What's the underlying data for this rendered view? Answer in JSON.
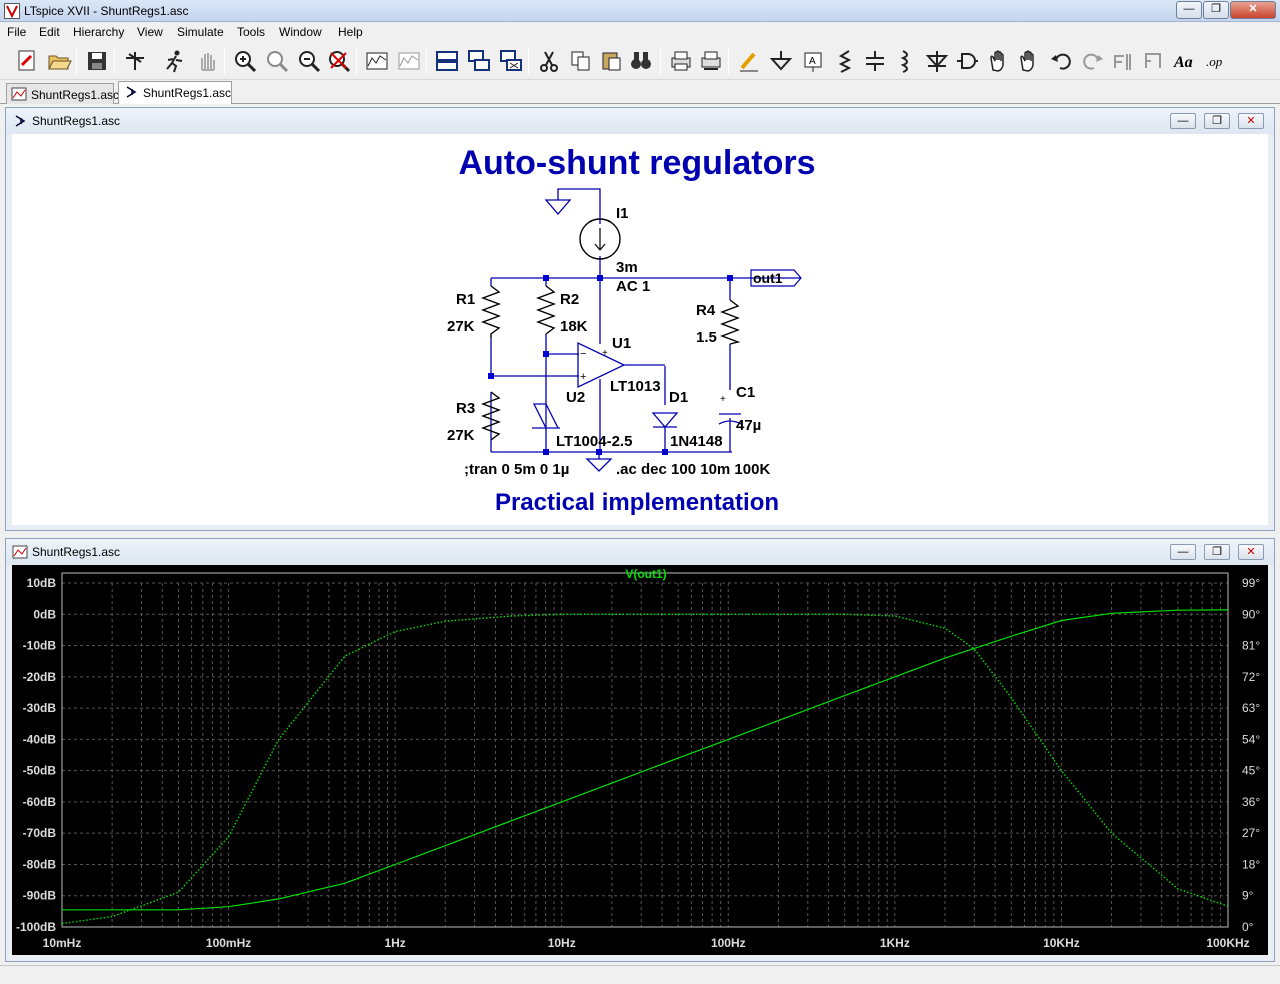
{
  "app": {
    "title": "LTspice XVII - ShuntRegs1.asc"
  },
  "menu": [
    "File",
    "Edit",
    "Hierarchy",
    "View",
    "Simulate",
    "Tools",
    "Window",
    "Help"
  ],
  "toolbar_icons": [
    "new-schematic-icon",
    "open-icon",
    "save-icon",
    "control-panel-icon",
    "run-icon",
    "halt-icon",
    "zoom-in-icon",
    "zoom-full-icon",
    "zoom-out-icon",
    "zoom-cancel-icon",
    "autorange-icon",
    "pick-visible-traces-icon",
    "tile-horizontal-icon",
    "cascade-icon",
    "close-windows-icon",
    "cut-icon",
    "copy-icon",
    "paste-icon",
    "find-icon",
    "print-icon",
    "print-setup-icon",
    "draw-wire-icon",
    "ground-icon",
    "label-net-icon",
    "resistor-icon",
    "capacitor-icon",
    "inductor-icon",
    "diode-icon",
    "component-icon",
    "move-icon",
    "drag-icon",
    "undo-icon",
    "redo-icon",
    "rotate-icon",
    "mirror-icon",
    "text-icon",
    "spice-directive-icon"
  ],
  "tabs": [
    "ShuntRegs1.asc",
    "ShuntRegs1.asc"
  ],
  "schematic": {
    "window_title": "ShuntRegs1.asc",
    "title": "Auto-shunt regulators",
    "subtitle": "Practical implementation",
    "labels": {
      "i1": "I1",
      "i1_val": "3m",
      "i1_ac": "AC 1",
      "r1": "R1",
      "r1_val": "27K",
      "r2": "R2",
      "r2_val": "18K",
      "r3": "R3",
      "r3_val": "27K",
      "r4": "R4",
      "r4_val": "1.5",
      "u1": "U1",
      "u1_model": "LT1013",
      "u2": "U2",
      "u2_model": "LT1004-2.5",
      "d1": "D1",
      "d1_model": "1N4148",
      "c1": "C1",
      "c1_val": "47µ",
      "out": "out1",
      "tran": ";tran 0 5m 0 1µ",
      "ac": ".ac dec 100 10m 100K"
    }
  },
  "waveform": {
    "window_title": "ShuntRegs1.asc",
    "trace": "V(out1)",
    "trace_color": "#00e000",
    "y_left_ticks": [
      "10dB",
      "0dB",
      "-10dB",
      "-20dB",
      "-30dB",
      "-40dB",
      "-50dB",
      "-60dB",
      "-70dB",
      "-80dB",
      "-90dB",
      "-100dB"
    ],
    "y_right_ticks": [
      "99°",
      "90°",
      "81°",
      "72°",
      "63°",
      "54°",
      "45°",
      "36°",
      "27°",
      "18°",
      "9°",
      "0°"
    ],
    "x_ticks": [
      "10mHz",
      "100mHz",
      "1Hz",
      "10Hz",
      "100Hz",
      "1KHz",
      "10KHz",
      "100KHz"
    ]
  },
  "chart_data": {
    "type": "line",
    "title": "V(out1)",
    "x_scale": "log",
    "xlim": [
      0.01,
      100000
    ],
    "ylim_left": [
      -100,
      10
    ],
    "ylim_right": [
      0,
      99
    ],
    "grid": true,
    "series": [
      {
        "name": "V(out1)",
        "axis": "left",
        "style": "solid",
        "x": [
          0.01,
          0.02,
          0.05,
          0.1,
          0.2,
          0.5,
          1,
          2,
          5,
          10,
          20,
          50,
          100,
          200,
          500,
          1000,
          2000,
          5000,
          10000,
          20000,
          50000,
          100000
        ],
        "y": [
          -94.5,
          -94.5,
          -94.5,
          -93.5,
          -91,
          -86,
          -80,
          -74,
          -66,
          -60,
          -54,
          -46,
          -40,
          -34,
          -26,
          -20,
          -14,
          -7,
          -2,
          0.3,
          1.3,
          1.4
        ]
      },
      {
        "name": "V(out1) phase",
        "axis": "right",
        "style": "dotted",
        "x": [
          0.01,
          0.02,
          0.05,
          0.1,
          0.2,
          0.5,
          1,
          2,
          5,
          10,
          20,
          50,
          100,
          200,
          500,
          1000,
          2000,
          3000,
          5000,
          10000,
          20000,
          50000,
          100000
        ],
        "y": [
          1,
          3,
          10,
          26,
          54,
          78,
          85,
          88,
          89.5,
          90,
          90,
          90,
          90,
          90,
          90,
          89.5,
          86,
          80,
          66,
          45,
          27,
          11,
          6
        ]
      }
    ]
  }
}
